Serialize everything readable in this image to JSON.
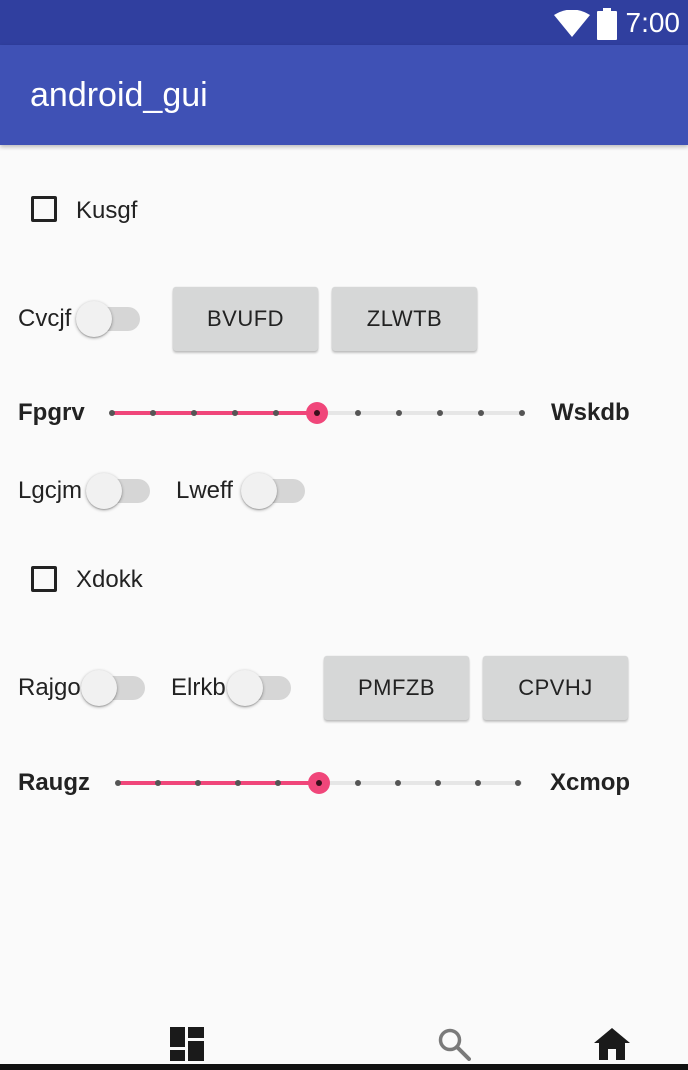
{
  "status_bar": {
    "time": "7:00",
    "icons": [
      "wifi-icon",
      "battery-icon"
    ]
  },
  "app_bar": {
    "title": "android_gui"
  },
  "form": {
    "checkbox_1": {
      "label": "Kusgf",
      "checked": false
    },
    "switch_cvcjf": {
      "label": "Cvcjf",
      "on": false
    },
    "button_bvufd": {
      "label": "BVUFD"
    },
    "button_zlwtb": {
      "label": "ZLWTB"
    },
    "slider_1": {
      "left_label": "Fpgrv",
      "right_label": "Wskdb",
      "steps": 10,
      "value": 5
    },
    "switch_lgcjm": {
      "label": "Lgcjm",
      "on": false
    },
    "switch_lweff": {
      "label": "Lweff",
      "on": false
    },
    "checkbox_2": {
      "label": "Xdokk",
      "checked": false
    },
    "switch_rajgo": {
      "label": "Rajgo",
      "on": false
    },
    "switch_elrkb": {
      "label": "Elrkb",
      "on": false
    },
    "button_pmfzb": {
      "label": "PMFZB"
    },
    "button_cpvhj": {
      "label": "CPVHJ"
    },
    "slider_2": {
      "left_label": "Raugz",
      "right_label": "Xcmop",
      "steps": 10,
      "value": 5
    }
  },
  "bottom_nav": {
    "items": [
      "dashboard-icon",
      "search-icon",
      "home-icon"
    ]
  },
  "colors": {
    "status_bar": "#303f9f",
    "app_bar": "#3f51b5",
    "accent": "#f0467a",
    "button": "#d6d7d7"
  }
}
